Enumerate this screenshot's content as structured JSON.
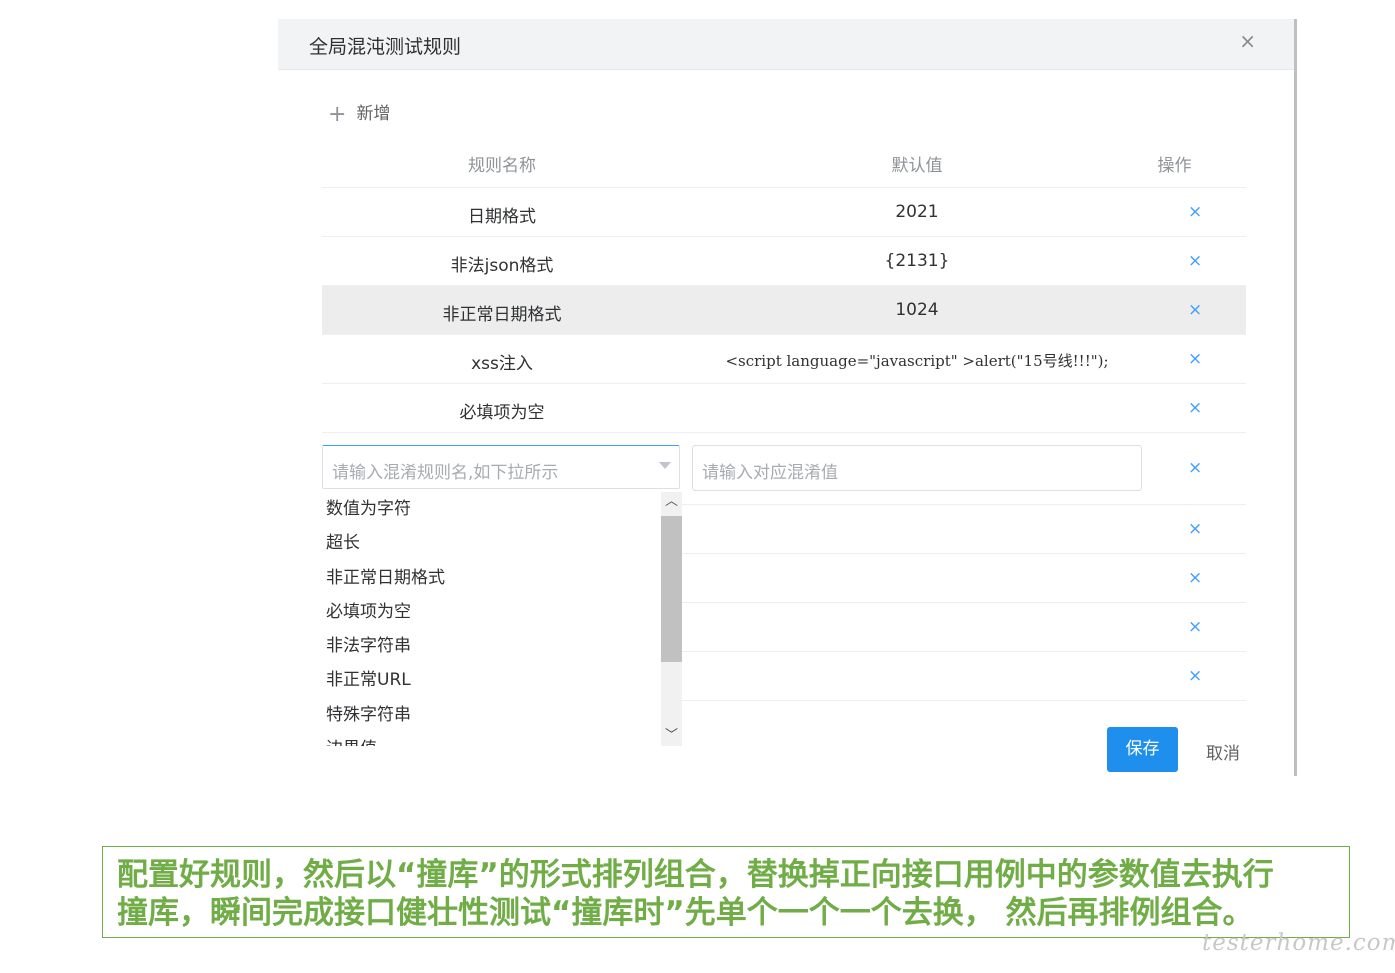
{
  "dialog": {
    "title": "全局混沌测试规则",
    "close_icon": "×",
    "add_label": "新增"
  },
  "table": {
    "headers": {
      "name": "规则名称",
      "default": "默认值",
      "action": "操作"
    },
    "rows": [
      {
        "name": "日期格式",
        "value": "2021"
      },
      {
        "name": "非法json格式",
        "value": "{2131}"
      },
      {
        "name": "非正常日期格式",
        "value": "1024"
      },
      {
        "name": "xss注入",
        "value": "<script language=\"javascript\" >alert(\"15号线!!!\");"
      },
      {
        "name": "必填项为空",
        "value": ""
      }
    ],
    "delete_icon": "×"
  },
  "edit_row": {
    "name_placeholder": "请输入混淆规则名,如下拉所示",
    "value_placeholder": "请输入对应混淆值"
  },
  "dropdown": {
    "options": [
      "数值为字符",
      "超长",
      "非正常日期格式",
      "必填项为空",
      "非法字符串",
      "非正常URL",
      "特殊字符串",
      "边界值"
    ]
  },
  "footer": {
    "save_label": "保存",
    "cancel_label": "取消"
  },
  "caption": {
    "line1": "配置好规则，然后以“撞库”的形式排列组合，替换掉正向接口用例中的参数值去执行",
    "line2": "撞库，瞬间完成接口健壮性测试“撞库时”先单个一个一个去换， 然后再排例组合。"
  },
  "watermark": "testerhome.com",
  "colors": {
    "primary": "#1f8fee",
    "delete": "#409eff",
    "caption": "#70ad47"
  }
}
